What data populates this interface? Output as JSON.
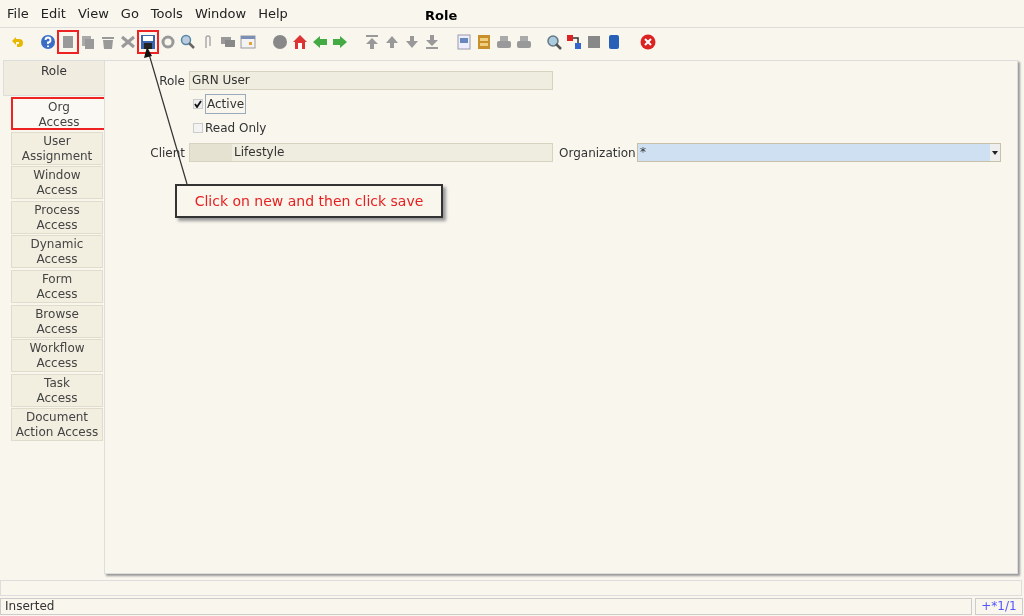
{
  "menu": [
    "File",
    "Edit",
    "View",
    "Go",
    "Tools",
    "Window",
    "Help"
  ],
  "window": {
    "title": "Role"
  },
  "toolbar": [
    {
      "highlighted": false
    },
    {
      "highlighted": false
    },
    {
      "highlighted": true
    },
    {
      "highlighted": false
    },
    {
      "highlighted": false
    },
    {
      "highlighted": false
    },
    {
      "highlighted": true
    },
    {
      "highlighted": false
    },
    {
      "highlighted": false
    },
    {
      "highlighted": false
    },
    {
      "highlighted": false
    },
    {
      "highlighted": false
    },
    {
      "highlighted": false
    },
    {
      "highlighted": false
    },
    {
      "highlighted": false
    },
    {
      "highlighted": false
    },
    {
      "highlighted": false
    },
    {
      "highlighted": false
    },
    {
      "highlighted": false
    },
    {
      "highlighted": false
    },
    {
      "highlighted": false
    },
    {
      "highlighted": false
    },
    {
      "highlighted": false
    },
    {
      "highlighted": false
    },
    {
      "highlighted": false
    },
    {
      "highlighted": false
    },
    {
      "highlighted": false
    },
    {
      "highlighted": false
    },
    {
      "highlighted": false
    }
  ],
  "tabs": [
    {
      "label": "Role",
      "selected": true,
      "highlighted": false
    },
    {
      "label": "Org\nAccess",
      "selected": false,
      "highlighted": true
    },
    {
      "label": "User\nAssignment",
      "selected": false,
      "highlighted": false
    },
    {
      "label": "Window\nAccess",
      "selected": false,
      "highlighted": false
    },
    {
      "label": "Process\nAccess",
      "selected": false,
      "highlighted": false
    },
    {
      "label": "Dynamic\nAccess",
      "selected": false,
      "highlighted": false
    },
    {
      "label": "Form\nAccess",
      "selected": false,
      "highlighted": false
    },
    {
      "label": "Browse\nAccess",
      "selected": false,
      "highlighted": false
    },
    {
      "label": "Workflow\nAccess",
      "selected": false,
      "highlighted": false
    },
    {
      "label": "Task\nAccess",
      "selected": false,
      "highlighted": false
    },
    {
      "label": "Document\nAction Access",
      "selected": false,
      "highlighted": false
    }
  ],
  "form": {
    "role_label": "Role",
    "role_value": "GRN User",
    "active": {
      "label": "Active",
      "checked": true
    },
    "read_only": {
      "label": "Read Only",
      "checked": false
    },
    "client_label": "Client",
    "client_value": "Lifestyle",
    "organization_label": "Organization",
    "organization_value": "*"
  },
  "callout": "Click on new and then click save",
  "status_bar": {
    "message": "Inserted",
    "record": "+*1/1"
  }
}
